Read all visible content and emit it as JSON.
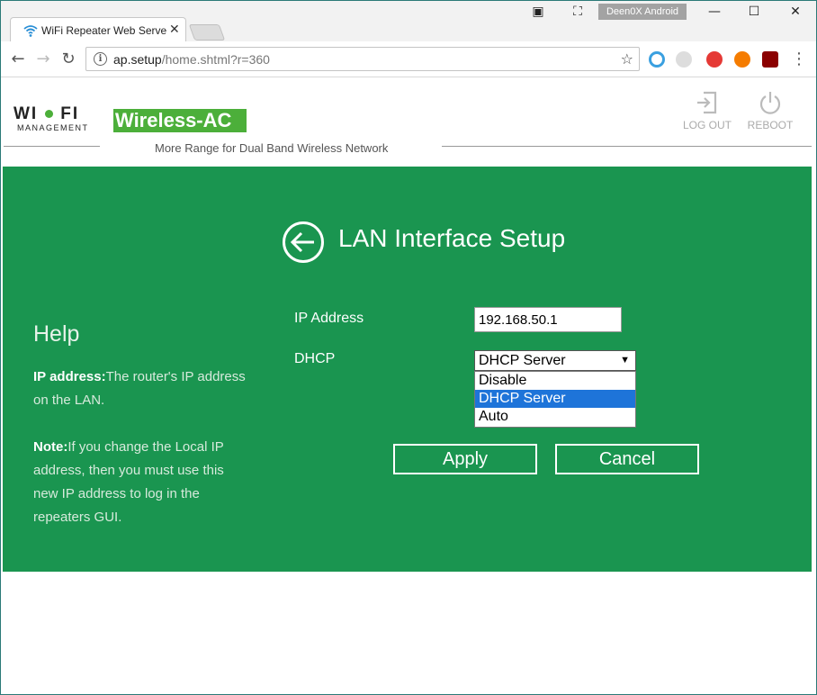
{
  "browser": {
    "tab_title": "WiFi Repeater Web Serve",
    "profile": "Deen0X Android",
    "url_host": "ap.setup",
    "url_path": "/home.shtml?r=360",
    "colors": {
      "titlebar": "#f2f2f2",
      "frame": "#2b7a78"
    }
  },
  "header": {
    "logo_left": "WI",
    "logo_right": "FI",
    "logo_sub": "MANAGEMENT",
    "brand": "Wireless-AC",
    "tagline": "More Range for Dual Band Wireless Network",
    "logout_label": "LOG OUT",
    "reboot_label": "REBOOT",
    "colors": {
      "brand_bg": "#4caf3a"
    }
  },
  "main": {
    "title": "LAN Interface Setup",
    "colors": {
      "background": "#1a9550",
      "selected_option": "#1e74d9"
    },
    "form": {
      "ip_label": "IP Address",
      "ip_value": "192.168.50.1",
      "dhcp_label": "DHCP",
      "dhcp_selected": "DHCP Server",
      "dhcp_options": [
        "Disable",
        "DHCP Server",
        "Auto"
      ],
      "apply_label": "Apply",
      "cancel_label": "Cancel"
    }
  },
  "help": {
    "title": "Help",
    "ip_heading": "IP address:",
    "ip_text": "The router's IP address on the LAN.",
    "note_heading": "Note:",
    "note_text": "If you change the Local IP address, then you must use this new IP address to log in the repeaters GUI."
  }
}
